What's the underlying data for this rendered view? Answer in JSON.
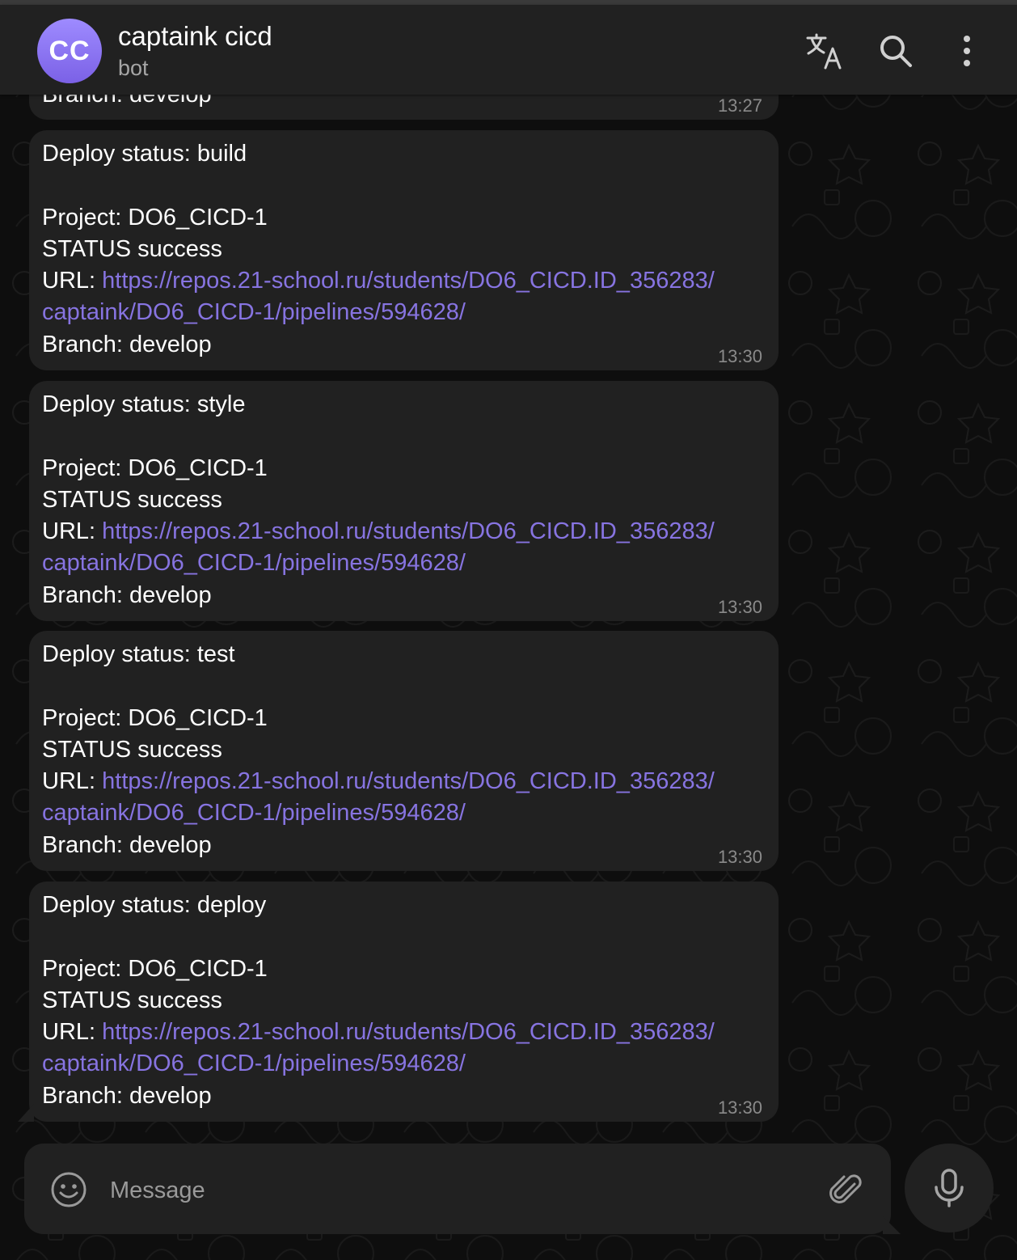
{
  "header": {
    "avatar_initials": "CC",
    "title": "captaink cicd",
    "subtitle": "bot",
    "icons": [
      "translate-icon",
      "search-icon",
      "more-vertical-icon"
    ]
  },
  "messages": [
    {
      "partial_text": "Branch: develop",
      "time": "13:27"
    },
    {
      "status_line": "Deploy status: build",
      "project_line": "Project: DO6_CICD-1",
      "status_result": "STATUS success",
      "url_label": "URL: ",
      "url_part1": "https://repos.21-school.ru/students/DO6_CICD.ID_356283/",
      "url_part2": "captaink/DO6_CICD-1/pipelines/594628/",
      "branch_line": "Branch: develop",
      "time": "13:30"
    },
    {
      "status_line": "Deploy status: style",
      "project_line": "Project: DO6_CICD-1",
      "status_result": "STATUS success",
      "url_label": "URL: ",
      "url_part1": "https://repos.21-school.ru/students/DO6_CICD.ID_356283/",
      "url_part2": "captaink/DO6_CICD-1/pipelines/594628/",
      "branch_line": "Branch: develop",
      "time": "13:30"
    },
    {
      "status_line": "Deploy status: test",
      "project_line": "Project: DO6_CICD-1",
      "status_result": "STATUS success",
      "url_label": "URL: ",
      "url_part1": "https://repos.21-school.ru/students/DO6_CICD.ID_356283/",
      "url_part2": "captaink/DO6_CICD-1/pipelines/594628/",
      "branch_line": "Branch: develop",
      "time": "13:30"
    },
    {
      "status_line": "Deploy status: deploy",
      "project_line": "Project: DO6_CICD-1",
      "status_result": "STATUS success",
      "url_label": "URL: ",
      "url_part1": "https://repos.21-school.ru/students/DO6_CICD.ID_356283/",
      "url_part2": "captaink/DO6_CICD-1/pipelines/594628/",
      "branch_line": "Branch: develop",
      "time": "13:30"
    }
  ],
  "composer": {
    "placeholder": "Message",
    "icons": [
      "emoji-icon",
      "paperclip-icon",
      "microphone-icon"
    ]
  },
  "colors": {
    "background": "#0e0e0e",
    "bubble": "#212121",
    "link": "#8774e1",
    "avatar": "#8f7cf5",
    "timestamp": "#8a8a8a"
  }
}
